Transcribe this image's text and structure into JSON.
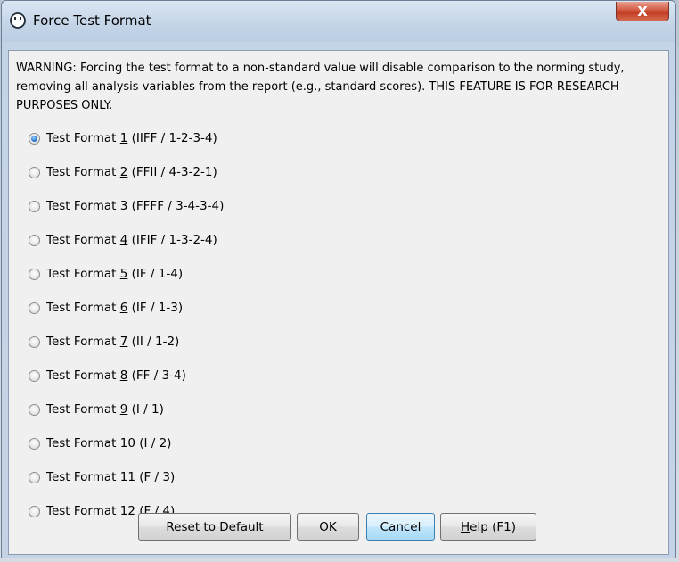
{
  "window": {
    "title": "Force Test Format",
    "close_label": "X"
  },
  "warning": "WARNING: Forcing the test format to a non-standard value will disable comparison to the norming study, removing all analysis variables from the report (e.g., standard scores). THIS FEATURE IS FOR RESEARCH PURPOSES ONLY.",
  "options": [
    {
      "prefix": "Test Format ",
      "mnemonic": "1",
      "suffix": " (IIFF / 1-2-3-4)",
      "selected": true
    },
    {
      "prefix": "Test Format ",
      "mnemonic": "2",
      "suffix": " (FFII / 4-3-2-1)",
      "selected": false
    },
    {
      "prefix": "Test Format ",
      "mnemonic": "3",
      "suffix": " (FFFF / 3-4-3-4)",
      "selected": false
    },
    {
      "prefix": "Test Format ",
      "mnemonic": "4",
      "suffix": " (IFIF / 1-3-2-4)",
      "selected": false
    },
    {
      "prefix": "Test Format ",
      "mnemonic": "5",
      "suffix": " (IF / 1-4)",
      "selected": false
    },
    {
      "prefix": "Test Format ",
      "mnemonic": "6",
      "suffix": " (IF / 1-3)",
      "selected": false
    },
    {
      "prefix": "Test Format ",
      "mnemonic": "7",
      "suffix": " (II / 1-2)",
      "selected": false
    },
    {
      "prefix": "Test Format ",
      "mnemonic": "8",
      "suffix": " (FF / 3-4)",
      "selected": false
    },
    {
      "prefix": "Test Format ",
      "mnemonic": "9",
      "suffix": " (I / 1)",
      "selected": false
    },
    {
      "prefix": "Test Format 10 (I / 2)",
      "mnemonic": "",
      "suffix": "",
      "selected": false
    },
    {
      "prefix": "Test Format 11 (F / 3)",
      "mnemonic": "",
      "suffix": "",
      "selected": false
    },
    {
      "prefix": "Test Format 12 (F / 4)",
      "mnemonic": "",
      "suffix": "",
      "selected": false
    }
  ],
  "buttons": {
    "reset": "Reset to Default",
    "ok": "OK",
    "cancel": "Cancel",
    "help_mnemonic": "H",
    "help_rest": "elp (F1)"
  }
}
